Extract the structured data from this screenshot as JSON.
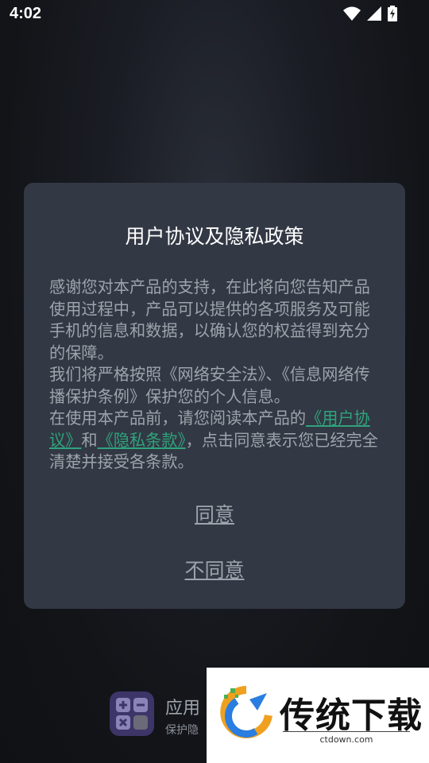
{
  "status_bar": {
    "time": "4:02"
  },
  "dialog": {
    "title": "用户协议及隐私政策",
    "paragraph1": "感谢您对本产品的支持，在此将向您告知产品使用过程中，产品可以提供的各项服务及可能手机的信息和数据，以确认您的权益得到充分的保障。",
    "paragraph2": "我们将严格按照《网络安全法》、《信息网络传播保护条例》保护您的个人信息。",
    "paragraph3_pre": "在使用本产品前，请您阅读本产品的",
    "user_agreement_link": "《用户协议》",
    "paragraph3_and": "和",
    "privacy_link": "《隐私条款》",
    "paragraph3_post": "，点击同意表示您已经完全清楚并接受各条款。",
    "agree_label": "同意",
    "disagree_label": "不同意"
  },
  "background_app": {
    "name": "应用",
    "subtitle": "保护隐"
  },
  "watermark": {
    "brand": "传统下载",
    "url": "ctdown.com"
  },
  "colors": {
    "link": "#2fa47c",
    "dialog_bg": "#323844",
    "body_text": "#9ea3ab"
  }
}
